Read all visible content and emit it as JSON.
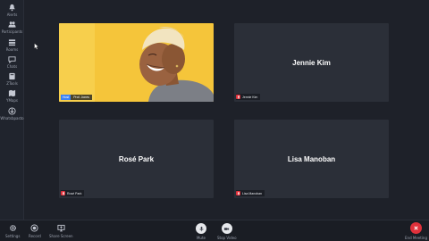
{
  "sidebar": {
    "items": [
      {
        "label": "Alerts",
        "icon": "bell-icon"
      },
      {
        "label": "Participants",
        "icon": "participants-icon"
      },
      {
        "label": "Rooms",
        "icon": "rooms-icon"
      },
      {
        "label": "Chats",
        "icon": "chat-icon"
      },
      {
        "label": "ZTools",
        "icon": "tools-icon"
      },
      {
        "label": "YMaps",
        "icon": "map-icon"
      },
      {
        "label": "Whatsbpasto",
        "icon": "whiteboard-icon"
      }
    ]
  },
  "tiles": [
    {
      "name": "Prof. Jones",
      "host_badge": "Host",
      "has_video": true
    },
    {
      "name": "Jennie Kim",
      "has_video": false,
      "muted": true
    },
    {
      "name": "Rosé Park",
      "has_video": false,
      "muted": true
    },
    {
      "name": "Lisa Manoban",
      "has_video": false,
      "muted": true
    }
  ],
  "bottombar": {
    "settings": "Settings",
    "record": "Record",
    "share": "Share Screen",
    "mute": "Mute",
    "stop_video": "Stop Video",
    "end": "End Meeting"
  },
  "colors": {
    "background": "#1e2129",
    "tile": "#2b2f38",
    "accent_red": "#e0313b",
    "host_blue": "#3b82f6",
    "photo_bg": "#f5c53a"
  }
}
